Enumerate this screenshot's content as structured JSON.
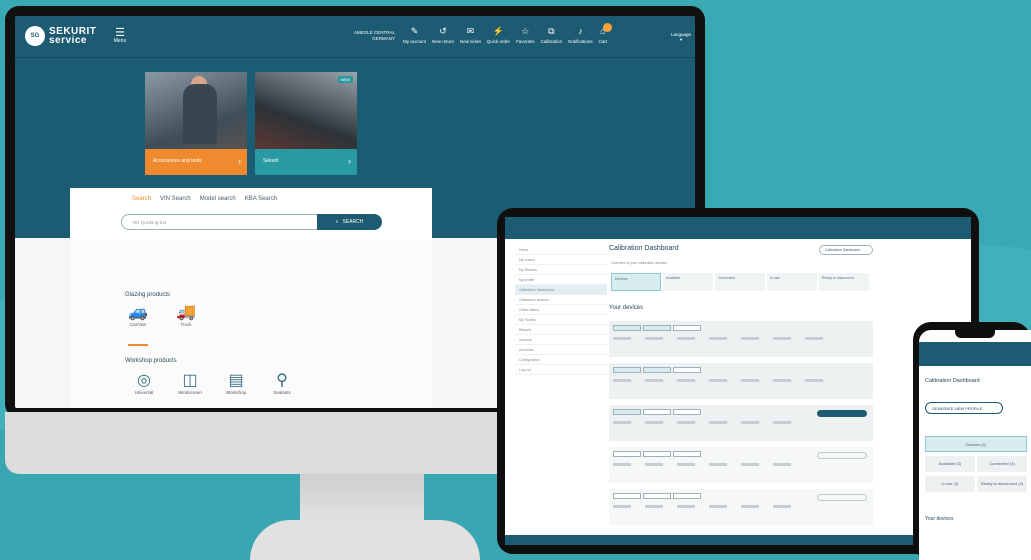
{
  "monitor": {
    "logo": {
      "line1": "SEKURIT",
      "line2": "service",
      "mark": "SG"
    },
    "menu_label": "Menu",
    "company": {
      "line1": "AMEGLE CENTRAL",
      "line2": "GERMANY"
    },
    "nav": [
      {
        "label": "My account",
        "icon": "pencil-icon"
      },
      {
        "label": "New return",
        "icon": "return-icon"
      },
      {
        "label": "New ticket",
        "icon": "ticket-icon"
      },
      {
        "label": "Quick order",
        "icon": "bolt-icon"
      },
      {
        "label": "Favorites",
        "icon": "star-icon"
      },
      {
        "label": "Calibration",
        "icon": "calibration-icon"
      },
      {
        "label": "Notifications",
        "icon": "bell-icon"
      },
      {
        "label": "Cart",
        "icon": "cart-icon"
      }
    ],
    "language_label": "Language",
    "cards": [
      {
        "label": "Accessories and tools"
      },
      {
        "label": "Sekurit",
        "badge": "NEW"
      }
    ],
    "search": {
      "tabs": [
        "Search",
        "VIN Search",
        "Model search",
        "KBA Search"
      ],
      "placeholder": "VIN Quicking Ext",
      "button": "SEARCH"
    },
    "glazing": {
      "title": "Glazing products",
      "items": [
        {
          "label": "Car/Van"
        },
        {
          "label": "Truck"
        }
      ]
    },
    "workshop": {
      "title": "Workshop products",
      "items": [
        {
          "label": "Universal"
        },
        {
          "label": "Windscreen"
        },
        {
          "label": "Workshop"
        },
        {
          "label": "Sealants"
        }
      ]
    }
  },
  "tablet": {
    "title": "Calibration Dashboard",
    "top_button": "Calibration Dashboard",
    "subtitle": "Overview of your calibration devices",
    "stats": [
      "Devices",
      "Available",
      "Connected",
      "In use",
      "Ready to disconnect"
    ],
    "devices_heading": "Your devices",
    "sidebar": [
      "Home",
      "My orders",
      "My Returns",
      "My profile",
      "Calibration Dashboard",
      "Calibration devices",
      "Order history",
      "My Tickets",
      "Reports",
      "Invoices",
      "Accounts",
      "Configuration",
      "Log out"
    ]
  },
  "phone": {
    "title": "Calibration Dashboard",
    "generate": "GENERATE NEW PROFILE",
    "tiles": [
      "Devices (4)",
      "Available (3)",
      "Connected (3)",
      "In use (3)",
      "Ready to disconnect (3)"
    ],
    "devices_heading": "Your devices"
  },
  "colors": {
    "brand": "#1d5b72",
    "accent": "#f08a2e",
    "teal": "#2a9aa2",
    "background": "#39a9b4"
  }
}
